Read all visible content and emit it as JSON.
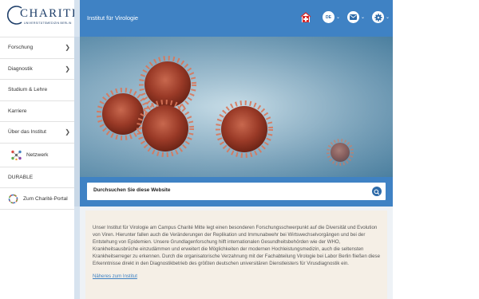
{
  "brand": {
    "name": "CHARITÉ",
    "subtitle": "UNIVERSITÄTSMEDIZIN BERLIN"
  },
  "sidebar": {
    "items": [
      {
        "label": "Forschung",
        "chevron": true
      },
      {
        "label": "Diagnostik",
        "chevron": true
      },
      {
        "label": "Studium & Lehre",
        "chevron": false
      },
      {
        "label": "Karriere",
        "chevron": false
      },
      {
        "label": "Über das Institut",
        "chevron": true
      },
      {
        "label": "Netzwerk",
        "icon": "network-icon"
      },
      {
        "label": "DURABLE"
      },
      {
        "label": "Zum Charité-Portal",
        "icon": "charite-portal-icon"
      }
    ],
    "chevron_glyph": "❯"
  },
  "header": {
    "title": "Institut für Virologie",
    "language": "DE",
    "icons": [
      "emergency-cross-icon",
      "language-icon",
      "mail-icon",
      "settings-gear-icon"
    ],
    "caret": "⌄",
    "accent": "#3f82c4"
  },
  "hero": {
    "description": "Coronavirus illustration",
    "icon": "virus-image"
  },
  "search": {
    "placeholder": "Durchsuchen Sie diese Website"
  },
  "intro": {
    "text": "Unser Institut für Virologie am Campus Charité Mitte legt einen besonderen Forschungsschwerpunkt auf die Diversität und Evolution von Viren. Hierunter fallen auch die Veränderungen der Replikation und Immunabwehr bei Wirtswechselvorgängen und bei der Entstehung von Epidemien. Unsere Grundlagenforschung hilft internationalen Gesundheitsbehörden wie der WHO, Krankheitsausbrüche einzudämmen und erweitert die Möglichkeiten der modernen Hochleistungsmedizin, auch die seltensten Krankheitserreger zu erkennen. Durch die organisatorische Verzahnung mit der Fachabteilung Virologie bei Labor Berlin fließen diese Erkenntnisse direkt in den Diagnostikbetrieb des größten deutschen universitären Dienstleisters für Virusdiagnostik ein.",
    "link": "Näheres zum Institut"
  }
}
